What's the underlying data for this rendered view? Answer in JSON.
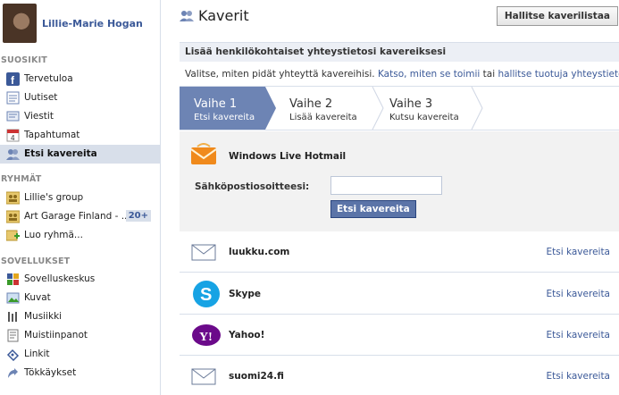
{
  "profile": {
    "name": "Lillie-Marie Hogan"
  },
  "sidebar": {
    "sections": [
      {
        "title": "SUOSIKIT",
        "items": [
          {
            "label": "Tervetuloa",
            "icon": "facebook-icon"
          },
          {
            "label": "Uutiset",
            "icon": "news-feed-icon"
          },
          {
            "label": "Viestit",
            "icon": "messages-icon"
          },
          {
            "label": "Tapahtumat",
            "icon": "calendar-icon"
          },
          {
            "label": "Etsi kavereita",
            "icon": "friends-icon",
            "selected": true
          }
        ]
      },
      {
        "title": "RYHMÄT",
        "items": [
          {
            "label": "Lillie's group",
            "icon": "group-icon"
          },
          {
            "label": "Art Garage Finland - ...",
            "icon": "group-icon",
            "badge": "20+"
          },
          {
            "label": "Luo ryhmä...",
            "icon": "create-group-icon"
          }
        ]
      },
      {
        "title": "SOVELLUKSET",
        "items": [
          {
            "label": "Sovelluskeskus",
            "icon": "app-center-icon"
          },
          {
            "label": "Kuvat",
            "icon": "photos-icon"
          },
          {
            "label": "Musiikki",
            "icon": "music-icon"
          },
          {
            "label": "Muistiinpanot",
            "icon": "notes-icon"
          },
          {
            "label": "Linkit",
            "icon": "links-icon"
          },
          {
            "label": "Tökkäykset",
            "icon": "pokes-icon"
          }
        ]
      }
    ]
  },
  "main": {
    "title": "Kaverit",
    "manage_button": "Hallitse kaverilistaa",
    "section_title": "Lisää henkilökohtaiset yhteystietosi kavereiksesi",
    "description": {
      "text": "Valitse, miten pidät yhteyttä kavereihisi.",
      "link1": "Katso, miten se toimii",
      "between": "tai",
      "link2": "hallitse tuotuja yhteystietoja",
      "end": "."
    },
    "steps": [
      {
        "title": "Vaihe 1",
        "subtitle": "Etsi kavereita",
        "active": true
      },
      {
        "title": "Vaihe 2",
        "subtitle": "Lisää kavereita"
      },
      {
        "title": "Vaihe 3",
        "subtitle": "Kutsu kavereita"
      }
    ],
    "active_provider": {
      "name": "Windows Live Hotmail",
      "email_label": "Sähköpostiosoitteesi:",
      "email_value": "",
      "button": "Etsi kavereita"
    },
    "providers": [
      {
        "name": "luukku.com",
        "icon": "envelope-icon",
        "link": "Etsi kavereita"
      },
      {
        "name": "Skype",
        "icon": "skype-icon",
        "link": "Etsi kavereita"
      },
      {
        "name": "Yahoo!",
        "icon": "yahoo-icon",
        "link": "Etsi kavereita"
      },
      {
        "name": "suomi24.fi",
        "icon": "envelope-icon",
        "link": "Etsi kavereita"
      }
    ]
  },
  "colors": {
    "brand": "#3b5998",
    "step_active": "#6d84b4",
    "sidebar_selected": "#d8dfea"
  }
}
